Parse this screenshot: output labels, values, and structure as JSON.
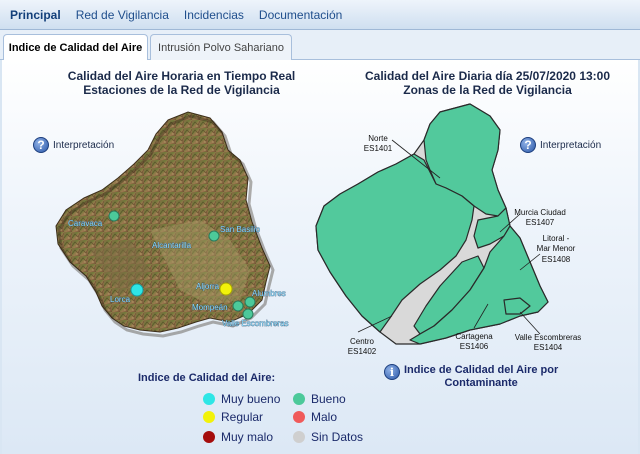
{
  "nav": {
    "items": [
      {
        "label": "Principal",
        "active": true
      },
      {
        "label": "Red de Vigilancia"
      },
      {
        "label": "Incidencias"
      },
      {
        "label": "Documentación"
      }
    ]
  },
  "tabs": [
    {
      "label": "Indice de Calidad del Aire",
      "active": true
    },
    {
      "label": "Intrusión Polvo Sahariano"
    }
  ],
  "left": {
    "title1": "Calidad del Aire Horaria en Tiempo Real",
    "title2": "Estaciones de la Red de Vigilancia",
    "help_label": "Interpretación",
    "stations": [
      {
        "name": "Caravaca",
        "status": "Bueno"
      },
      {
        "name": "San Basilio",
        "status": "Bueno"
      },
      {
        "name": "Alcantarilla",
        "status": "Bueno"
      },
      {
        "name": "Aljorra",
        "status": "Regular"
      },
      {
        "name": "Lorca",
        "status": "Muy bueno"
      },
      {
        "name": "Alumbres",
        "status": "Bueno"
      },
      {
        "name": "Mompeán",
        "status": "Bueno"
      },
      {
        "name": "Valle Escombreras",
        "status": "Bueno"
      }
    ]
  },
  "right": {
    "title1": "Calidad del Aire Diaria día 25/07/2020 13:00",
    "title2": "Zonas de la Red de Vigilancia",
    "help_label": "Interpretación",
    "zones": [
      {
        "name": "Norte",
        "code": "ES1401"
      },
      {
        "name": "Murcia Ciudad",
        "code": "ES1407"
      },
      {
        "name": "Litoral - Mar Menor",
        "code": "ES1408"
      },
      {
        "name": "Centro",
        "code": "ES1402"
      },
      {
        "name": "Cartagena",
        "code": "ES1406"
      },
      {
        "name": "Valle Escombreras",
        "code": "ES1404"
      }
    ],
    "link_line1": "Indice de Calidad del Aire por",
    "link_line2": "Contaminante"
  },
  "legend": {
    "title": "Indice de Calidad del Aire:",
    "items": [
      {
        "label": "Muy bueno",
        "color": "#2ee6e6"
      },
      {
        "label": "Bueno",
        "color": "#4cc99a"
      },
      {
        "label": "Regular",
        "color": "#f2f20a"
      },
      {
        "label": "Malo",
        "color": "#f05a5a"
      },
      {
        "label": "Muy malo",
        "color": "#a50d0d"
      },
      {
        "label": "Sin Datos",
        "color": "#cfcfcf"
      }
    ]
  }
}
